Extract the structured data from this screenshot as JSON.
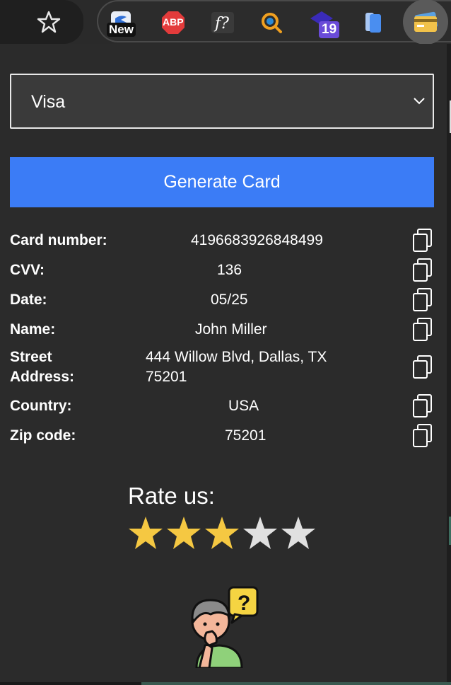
{
  "toolbar": {
    "badge_new": "New",
    "abp_label": "ABP",
    "badge_count": "19"
  },
  "selector": {
    "value": "Visa"
  },
  "generate_button": "Generate Card",
  "fields": [
    {
      "label": "Card number:",
      "value": "4196683926848499"
    },
    {
      "label": "CVV:",
      "value": "136"
    },
    {
      "label": "Date:",
      "value": "05/25"
    },
    {
      "label": "Name:",
      "value": "John Miller"
    },
    {
      "label_line1": "Street",
      "label_line2": "Address:",
      "value_line1": "444 Willow Blvd, Dallas, TX",
      "value_line2": "75201"
    },
    {
      "label": "Country:",
      "value": "USA"
    },
    {
      "label": "Zip code:",
      "value": "75201"
    }
  ],
  "rating": {
    "title": "Rate us:",
    "stars_filled": 3,
    "stars_total": 5,
    "filled_color": "#f5c842",
    "empty_color": "#e0e0e0"
  },
  "colors": {
    "accent": "#3b7cf6",
    "background": "#2b2b2b"
  }
}
